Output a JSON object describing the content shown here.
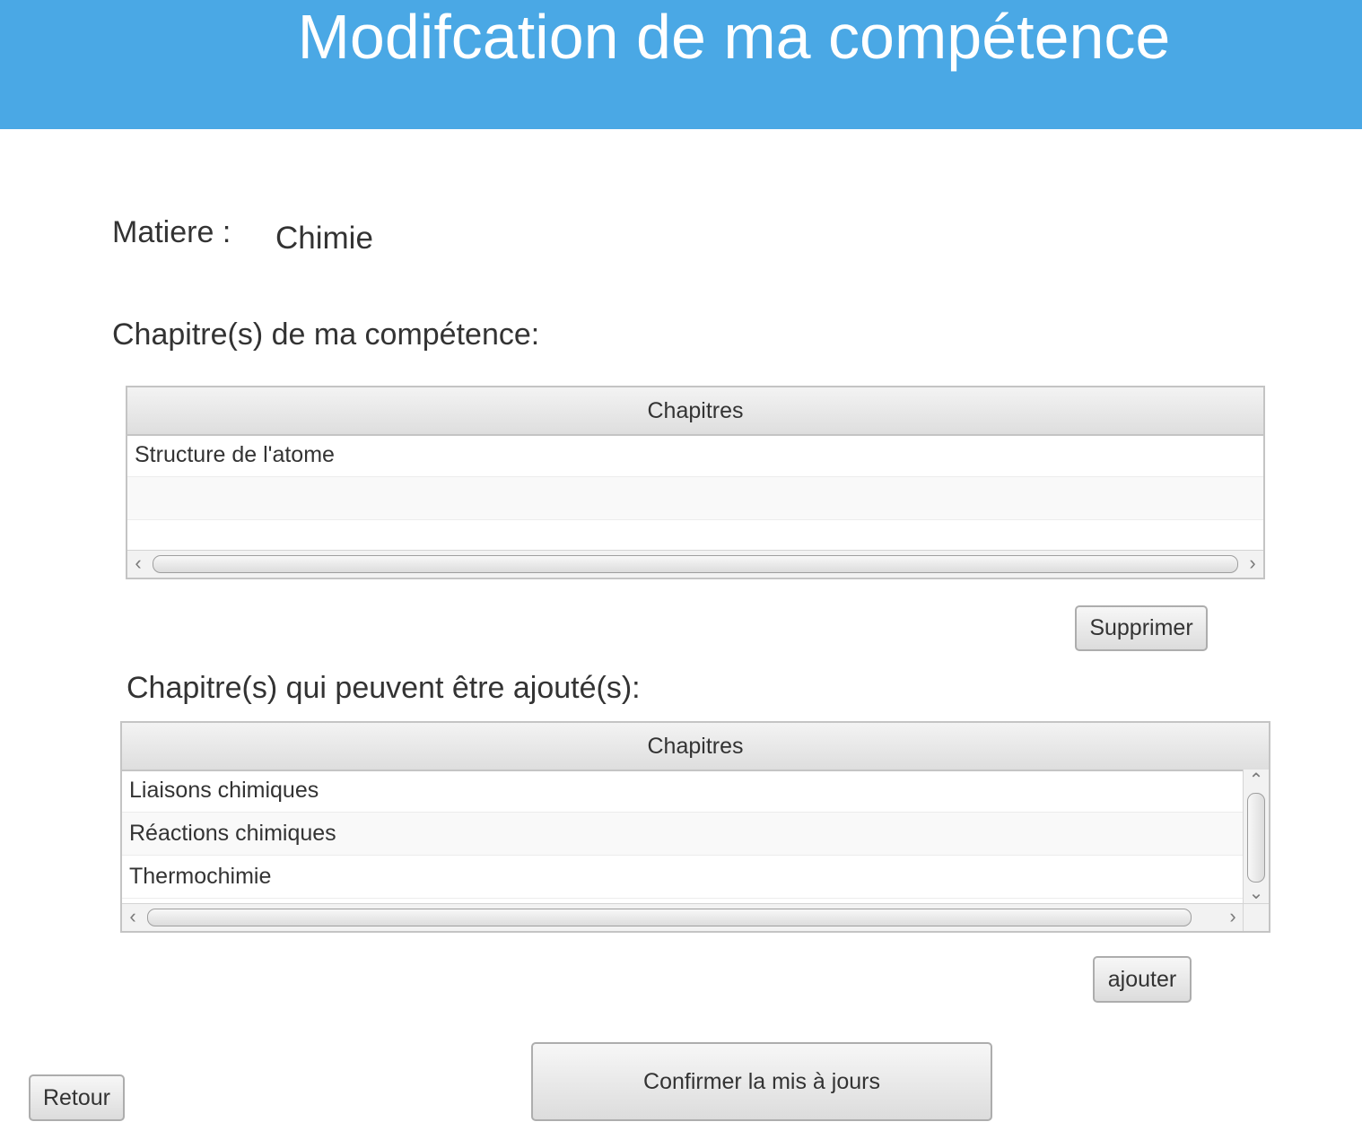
{
  "header": {
    "title": "Modifcation de ma compétence"
  },
  "matiere": {
    "label": "Matiere :",
    "value": "Chimie"
  },
  "competence_section": {
    "title": "Chapitre(s) de ma compétence:",
    "table": {
      "column": "Chapitres",
      "rows": [
        "Structure de l'atome",
        "",
        ""
      ]
    },
    "delete_label": "Supprimer"
  },
  "addable_section": {
    "title": "Chapitre(s) qui peuvent être ajouté(s):",
    "table": {
      "column": "Chapitres",
      "rows": [
        "Liaisons chimiques",
        "Réactions chimiques",
        "Thermochimie"
      ]
    },
    "add_label": "ajouter"
  },
  "footer": {
    "confirm_label": "Confirmer la mis à jours",
    "back_label": "Retour"
  },
  "colors": {
    "header_bg": "#4aa8e5",
    "text": "#333333"
  },
  "icons": {
    "scroll_left": "‹",
    "scroll_right": "›",
    "scroll_up": "⌃",
    "scroll_down": "⌄"
  }
}
